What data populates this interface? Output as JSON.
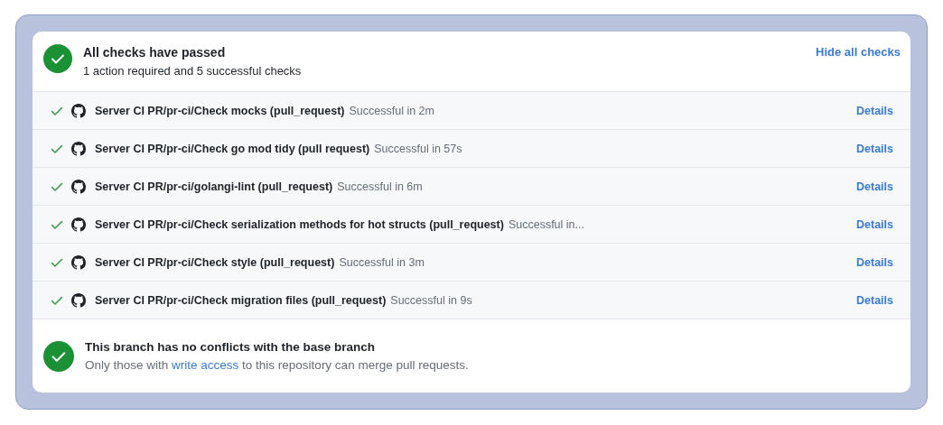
{
  "summary": {
    "title": "All checks have passed",
    "subtitle": "1 action required and 5 successful checks",
    "toggle": "Hide all checks"
  },
  "checks": [
    {
      "name": "Server CI PR/pr-ci/Check mocks (pull_request)",
      "status": "Successful in 2m",
      "link": "Details"
    },
    {
      "name": "Server CI PR/pr-ci/Check go mod tidy (pull request)",
      "status": "Successful in 57s",
      "link": "Details"
    },
    {
      "name": "Server CI PR/pr-ci/golangi-lint (pull_request)",
      "status": "Successful in 6m",
      "link": "Details"
    },
    {
      "name": "Server CI PR/pr-ci/Check serialization methods for hot structs (pull_request)",
      "status": "Successful in...",
      "link": "Details"
    },
    {
      "name": "Server CI PR/pr-ci/Check style (pull_request)",
      "status": "Successful in 3m",
      "link": "Details"
    },
    {
      "name": "Server CI PR/pr-ci/Check migration files (pull_request)",
      "status": "Successful in 9s",
      "link": "Details"
    }
  ],
  "merge": {
    "title": "This branch has no conflicts with the base branch",
    "text_before": "Only those with",
    "link": "write access",
    "text_after": "to this repository can merge pull requests."
  }
}
